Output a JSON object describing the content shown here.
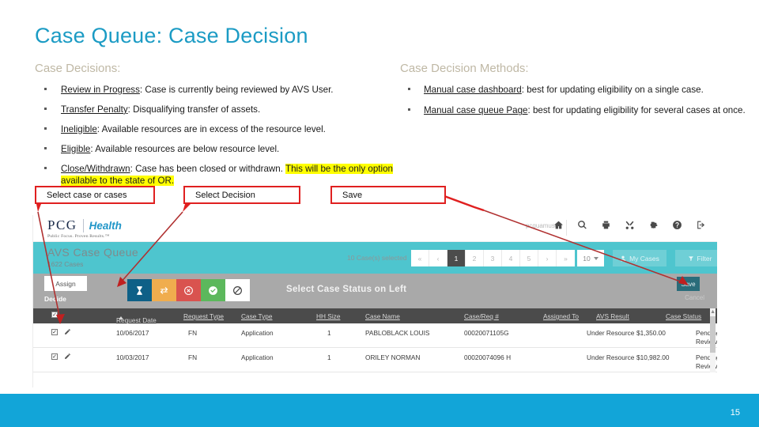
{
  "slide": {
    "title": "Case Queue: Case Decision",
    "page_number": "15",
    "accent_color": "#1B9BC4",
    "footer_color": "#12A5D8",
    "callout_border_color": "#E02020",
    "highlight_color": "#FFFF00"
  },
  "left_column": {
    "heading": "Case Decisions:",
    "items": [
      {
        "term": "Review in Progress",
        "rest": ": Case is currently being reviewed by AVS User."
      },
      {
        "term": "Transfer Penalty",
        "rest": ": Disqualifying transfer of assets."
      },
      {
        "term": "Ineligible",
        "rest": ": Available resources are in excess of the resource level."
      },
      {
        "term": "Eligible",
        "rest": ": Available resources are below resource level."
      },
      {
        "term": "Close/Withdrawn",
        "rest": ": Case has been closed or withdrawn. ",
        "highlight": "This will be the only option available to the state of OR."
      }
    ]
  },
  "right_column": {
    "heading": "Case Decision Methods:",
    "items": [
      {
        "term": "Manual case dashboard",
        "rest": ": best for updating eligibility on a single case."
      },
      {
        "term": "Manual case queue Page",
        "rest": ": best for updating eligibility for several cases at once."
      }
    ]
  },
  "callouts": {
    "select_case": "Select case or cases",
    "select_decision": "Select Decision",
    "save": "Save"
  },
  "app": {
    "logo": {
      "pcg": "PCG",
      "health": "Health",
      "tagline": "Public Focus. Proven Results.™"
    },
    "username": "pcguamuser",
    "top_icons": [
      "home-icon",
      "search-icon",
      "print-icon",
      "tools-icon",
      "gear-icon",
      "help-icon",
      "logout-icon"
    ],
    "band": {
      "title": "AVS Case Queue",
      "subtitle": "1622 Cases",
      "selected_text": "10  Case(s) selected",
      "pages": [
        "«",
        "‹",
        "1",
        "2",
        "3",
        "4",
        "5",
        "›",
        "»"
      ],
      "active_page": "1",
      "page_size": "10",
      "my_cases_label": "My Cases",
      "filter_label": "Filter"
    },
    "toolbar": {
      "assign_label": "Assign",
      "decide_label": "Decide",
      "prompt": "Select Case Status on Left",
      "save_label": "Save",
      "cancel_label": "Cancel",
      "status_buttons": [
        {
          "name": "review-in-progress",
          "icon": "hourglass-icon",
          "color": "#0E6087"
        },
        {
          "name": "transfer-penalty",
          "icon": "transfer-arrows-icon",
          "color": "#F0AD4E"
        },
        {
          "name": "ineligible",
          "icon": "circle-x-icon",
          "color": "#D9534F"
        },
        {
          "name": "eligible",
          "icon": "circle-check-icon",
          "color": "#5CB85C"
        },
        {
          "name": "close-withdrawn",
          "icon": "prohibited-icon",
          "color": "#FFFFFF"
        }
      ]
    },
    "table": {
      "headers": [
        "Request Date",
        "Request Type",
        "Case Type",
        "HH Size",
        "Case Name",
        "Case/Req #",
        "Assigned To",
        "AVS Result",
        "Case Status"
      ],
      "sort_column": "Request Date",
      "sort_direction": "asc",
      "rows": [
        {
          "request_date": "10/06/2017",
          "request_type": "FN",
          "case_type": "Application",
          "hh_size": "1",
          "case_name": "PABLOBLACK LOUIS",
          "case_req": "00020071105G",
          "assigned_to": "",
          "avs_result": "Under Resource",
          "amount": "$1,350.00",
          "case_status": "Pending Review"
        },
        {
          "request_date": "10/03/2017",
          "request_type": "FN",
          "case_type": "Application",
          "hh_size": "1",
          "case_name": "ORILEY NORMAN",
          "case_req": "00020074096 H",
          "assigned_to": "",
          "avs_result": "Under Resource",
          "amount": "$10,982.00",
          "case_status": "Pending Review"
        }
      ]
    }
  }
}
